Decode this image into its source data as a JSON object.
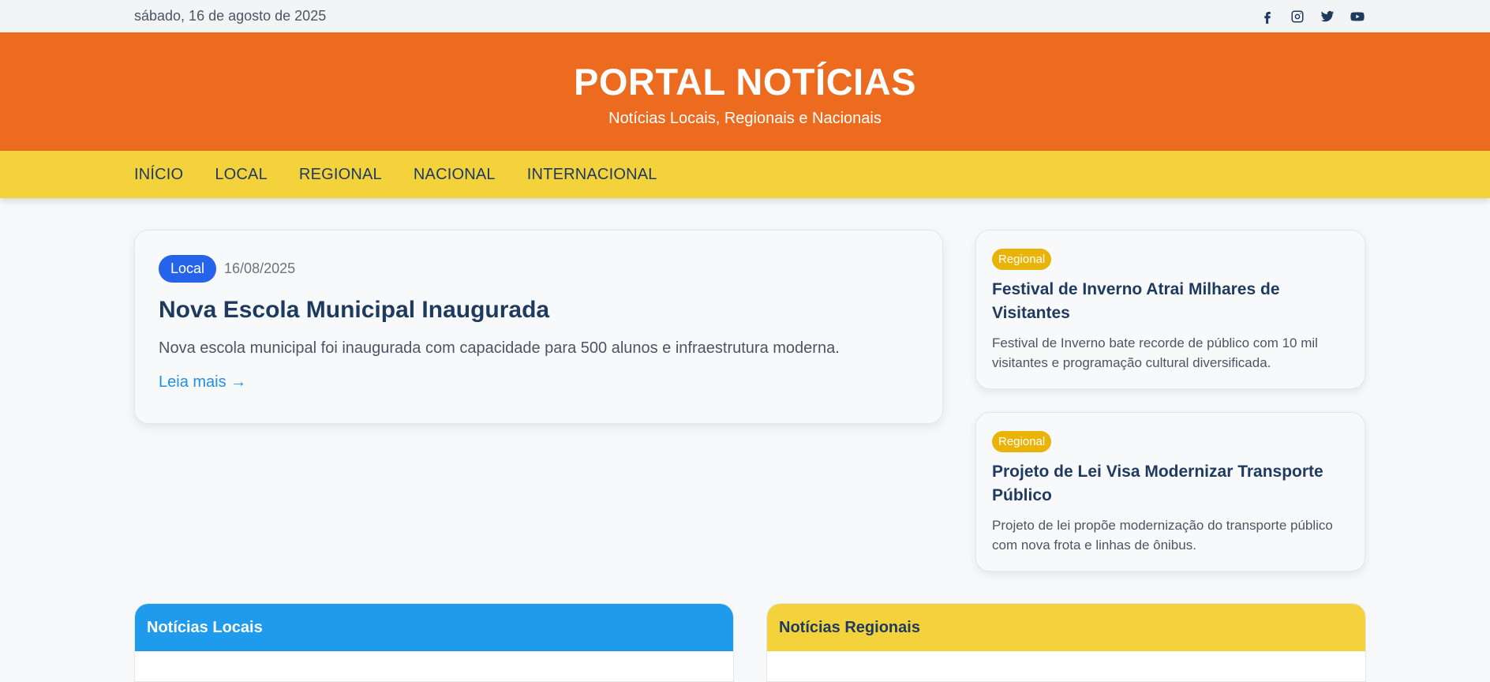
{
  "topbar": {
    "date": "sábado, 16 de agosto de 2025",
    "social": [
      "facebook-icon",
      "instagram-icon",
      "twitter-icon",
      "youtube-icon"
    ]
  },
  "header": {
    "title": "PORTAL NOTÍCIAS",
    "subtitle": "Notícias Locais, Regionais e Nacionais"
  },
  "nav": {
    "items": [
      "INÍCIO",
      "LOCAL",
      "REGIONAL",
      "NACIONAL",
      "INTERNACIONAL"
    ]
  },
  "featured": {
    "category": "Local",
    "date": "16/08/2025",
    "title": "Nova Escola Municipal Inaugurada",
    "summary": "Nova escola municipal foi inaugurada com capacidade para 500 alunos e infraestrutura moderna.",
    "more": "Leia mais →"
  },
  "side": [
    {
      "category": "Regional",
      "title": "Festival de Inverno Atrai Milhares de Visitantes",
      "summary": "Festival de Inverno bate recorde de público com 10 mil visitantes e programação cultural diversificada."
    },
    {
      "category": "Regional",
      "title": "Projeto de Lei Visa Modernizar Transporte Público",
      "summary": "Projeto de lei propõe modernização do transporte público com nova frota e linhas de ônibus."
    }
  ],
  "sections": {
    "local": "Notícias Locais",
    "regional": "Notícias Regionais"
  },
  "colors": {
    "header": "#ec6b1e",
    "nav": "#f4d23c",
    "local": "#1e9bec",
    "badge_local": "#2563eb",
    "badge_regional": "#eab308",
    "title_text": "#1e3a5f"
  }
}
